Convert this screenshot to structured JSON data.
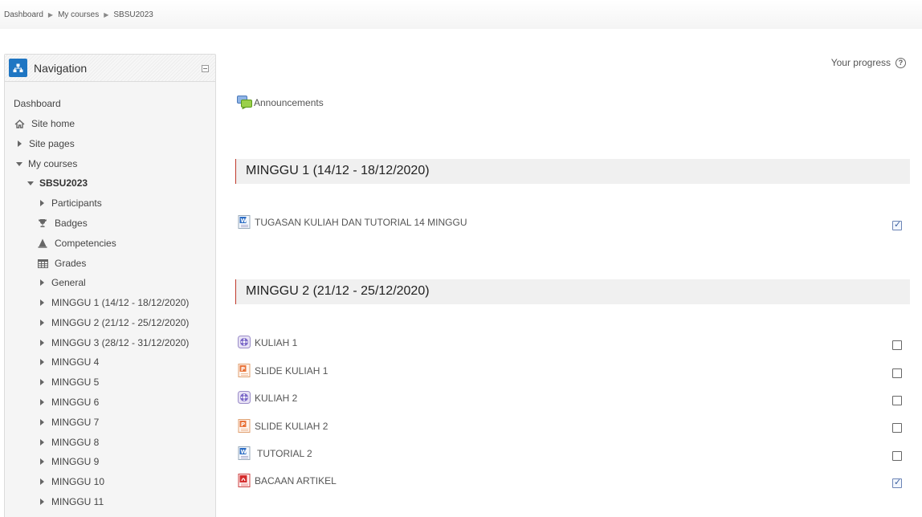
{
  "breadcrumb": [
    "Dashboard",
    "My courses",
    "SBSU2023"
  ],
  "breadcrumb_sep": "▶",
  "navigation": {
    "title": "Navigation",
    "items": [
      {
        "label": "Dashboard"
      },
      {
        "label": "Site home",
        "icon": "home-icon"
      },
      {
        "label": "Site pages"
      },
      {
        "label": "My courses"
      },
      {
        "label": "SBSU2023"
      },
      {
        "label": "Participants"
      },
      {
        "label": "Badges",
        "icon": "trophy-icon"
      },
      {
        "label": "Competencies",
        "icon": "competencies-icon"
      },
      {
        "label": "Grades",
        "icon": "table-icon"
      },
      {
        "label": "General"
      },
      {
        "label": "MINGGU 1 (14/12 - 18/12/2020)"
      },
      {
        "label": "MINGGU 2 (21/12 - 25/12/2020)"
      },
      {
        "label": "MINGGU 3 (28/12 - 31/12/2020)"
      },
      {
        "label": "MINGGU 4"
      },
      {
        "label": "MINGGU 5"
      },
      {
        "label": "MINGGU 6"
      },
      {
        "label": "MINGGU 7"
      },
      {
        "label": "MINGGU 8"
      },
      {
        "label": "MINGGU 9"
      },
      {
        "label": "MINGGU 10"
      },
      {
        "label": "MINGGU 11"
      }
    ]
  },
  "main": {
    "progress_label": "Your progress",
    "help_glyph": "?",
    "announcements": "Announcements",
    "sections": [
      {
        "title": "MINGGU 1 (14/12 - 18/12/2020)",
        "activities": [
          {
            "label": "TUGASAN KULIAH DAN TUTORIAL 14 MINGGU",
            "type": "word-doc-icon",
            "completed": true
          }
        ]
      },
      {
        "title": "MINGGU 2 (21/12 - 25/12/2020)",
        "activities": [
          {
            "label": "KULIAH 1",
            "type": "video-icon",
            "completed": false
          },
          {
            "label": "SLIDE KULIAH 1",
            "type": "powerpoint-icon",
            "completed": false
          },
          {
            "label": "KULIAH 2",
            "type": "video-icon",
            "completed": false
          },
          {
            "label": "SLIDE KULIAH 2",
            "type": "powerpoint-icon",
            "completed": false
          },
          {
            "label": "TUTORIAL 2",
            "type": "word-doc-icon",
            "completed": false
          },
          {
            "label": "BACAAN ARTIKEL",
            "type": "pdf-icon",
            "completed": true
          }
        ]
      }
    ]
  },
  "colors": {
    "nav_icon_bg": "#1f76c3",
    "section_accent": "#c0392b",
    "check": "#3b5f9f"
  }
}
